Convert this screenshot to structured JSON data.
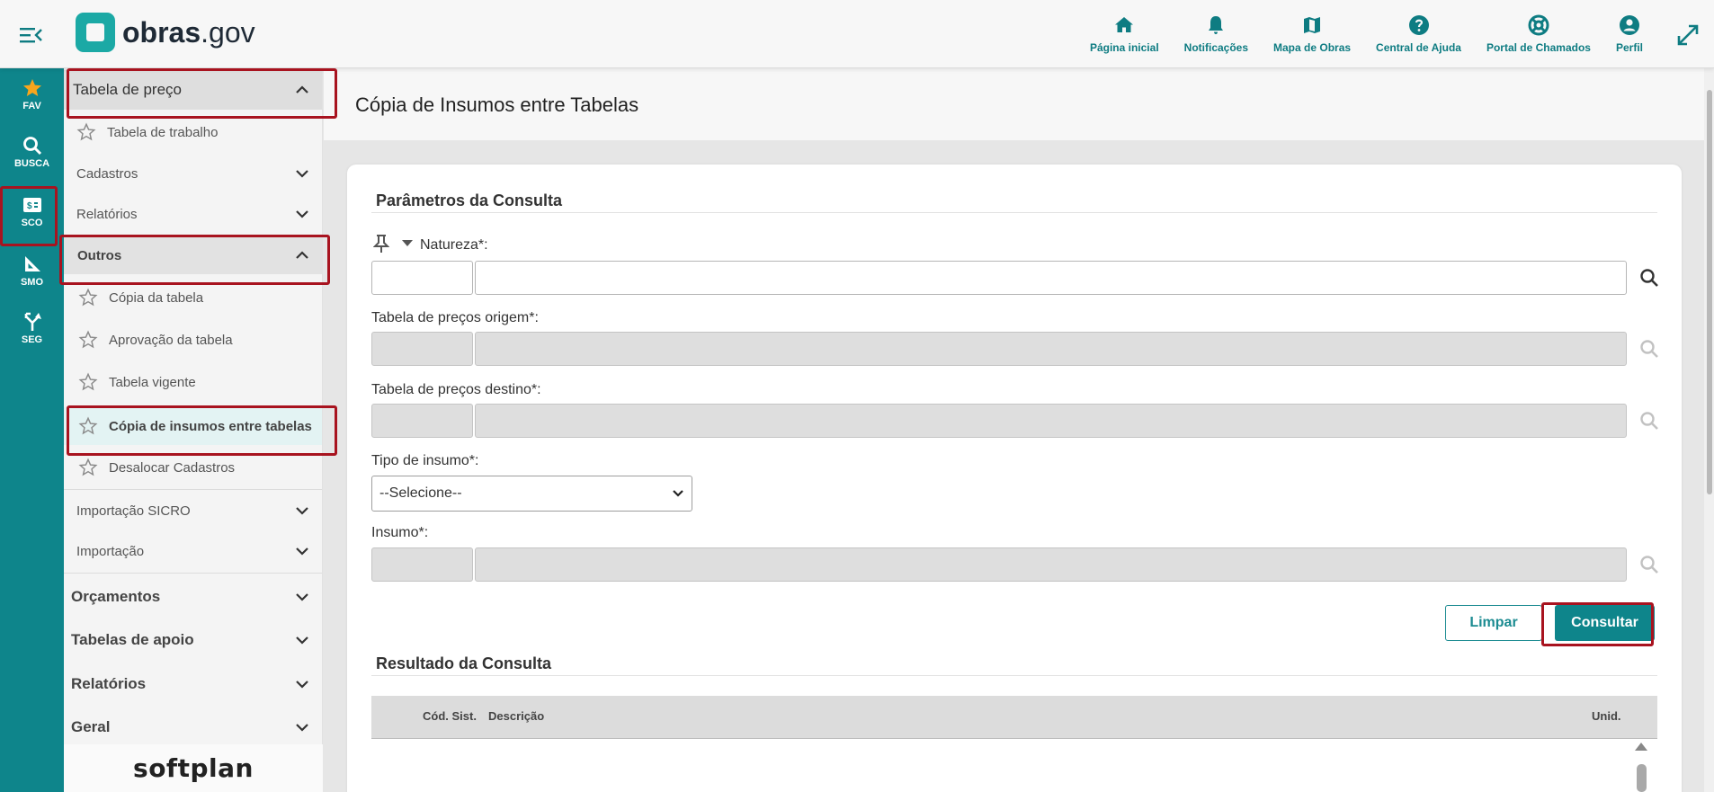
{
  "brand": {
    "name_bold": "obras",
    "name_light": ".gov",
    "footer": "softplan"
  },
  "topnav": [
    {
      "label": "Página inicial",
      "icon": "home-icon"
    },
    {
      "label": "Notificações",
      "icon": "bell-icon"
    },
    {
      "label": "Mapa de Obras",
      "icon": "map-icon"
    },
    {
      "label": "Central de Ajuda",
      "icon": "help-icon"
    },
    {
      "label": "Portal de Chamados",
      "icon": "lifebuoy-icon"
    },
    {
      "label": "Perfil",
      "icon": "user-icon"
    }
  ],
  "iconbar": [
    {
      "label": "FAV",
      "icon": "star-icon"
    },
    {
      "label": "BUSCA",
      "icon": "search-icon"
    },
    {
      "label": "SCO",
      "icon": "sco-icon"
    },
    {
      "label": "SMO",
      "icon": "ruler-icon"
    },
    {
      "label": "SEG",
      "icon": "merge-icon"
    }
  ],
  "menu": {
    "section": "Tabela de preço",
    "tabela_trabalho": "Tabela de trabalho",
    "cadastros": "Cadastros",
    "relatorios_sub": "Relatórios",
    "outros": "Outros",
    "outros_items": [
      "Cópia da tabela",
      "Aprovação da tabela",
      "Tabela vigente",
      "Cópia de insumos entre tabelas",
      "Desalocar Cadastros"
    ],
    "importacao_sicro": "Importação SICRO",
    "importacao": "Importação",
    "categories": [
      "Orçamentos",
      "Tabelas de apoio",
      "Relatórios",
      "Geral"
    ]
  },
  "page": {
    "title": "Cópia de Insumos entre Tabelas"
  },
  "form": {
    "section_title": "Parâmetros da Consulta",
    "natureza_label": "Natureza*:",
    "origem_label": "Tabela de preços origem*:",
    "destino_label": "Tabela de preços destino*:",
    "tipo_label": "Tipo de insumo*:",
    "tipo_selected": "--Selecione--",
    "insumo_label": "Insumo*:",
    "btn_limpar": "Limpar",
    "btn_consultar": "Consultar"
  },
  "result": {
    "section_title": "Resultado da Consulta",
    "columns": [
      "Cód. Sist.",
      "Descrição",
      "Unid."
    ]
  },
  "colors": {
    "primary": "#0e858b",
    "highlight": "#a8131f",
    "fav": "#f8a51c"
  }
}
